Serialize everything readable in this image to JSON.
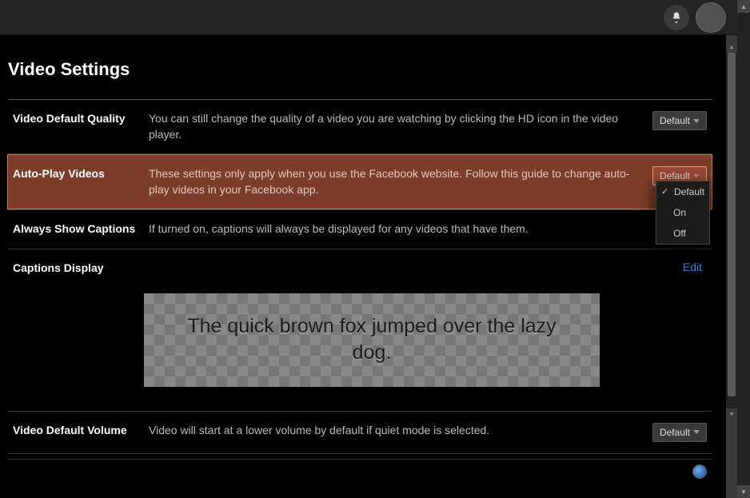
{
  "page_title": "Video Settings",
  "header": {
    "notifications_icon": "bell-icon",
    "avatar": "user"
  },
  "rows": {
    "quality": {
      "label": "Video Default Quality",
      "desc": "You can still change the quality of a video you are watching by clicking the HD icon in the video player.",
      "select_value": "Default"
    },
    "autoplay": {
      "label": "Auto-Play Videos",
      "desc": "These settings only apply when you use the Facebook website. Follow this guide to change auto-play videos in your Facebook app.",
      "select_value": "Default",
      "dropdown": [
        "Default",
        "On",
        "Off"
      ],
      "dropdown_selected": "Default"
    },
    "captions_always": {
      "label": "Always Show Captions",
      "desc": "If turned on, captions will always be displayed for any videos that have them."
    },
    "captions_display": {
      "label": "Captions Display",
      "edit_label": "Edit",
      "preview_text": "The quick brown fox jumped over the lazy dog."
    },
    "volume": {
      "label": "Video Default Volume",
      "desc": "Video will start at a lower volume by default if quiet mode is selected.",
      "select_value": "Default"
    }
  }
}
